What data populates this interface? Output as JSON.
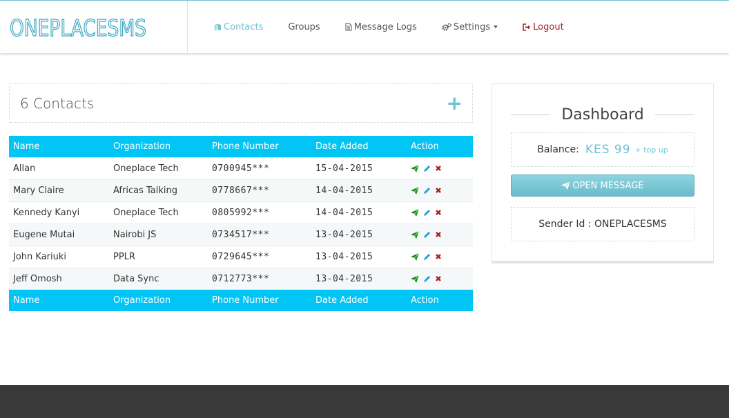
{
  "brand": {
    "name": "ONEPLACESMS"
  },
  "nav": {
    "items": [
      {
        "label": "Contacts",
        "icon": "book-icon",
        "active": true
      },
      {
        "label": "Groups",
        "icon": "",
        "active": false
      },
      {
        "label": "Message Logs",
        "icon": "file-text-icon",
        "active": false
      },
      {
        "label": "Settings",
        "icon": "cogs-icon",
        "active": false,
        "dropdown": true
      },
      {
        "label": "Logout",
        "icon": "sign-out-icon",
        "active": false
      }
    ]
  },
  "contacts": {
    "title": "6 Contacts",
    "add_label": "+",
    "columns": [
      "Name",
      "Organization",
      "Phone Number",
      "Date Added",
      "Action"
    ],
    "rows": [
      {
        "name": "Allan",
        "organization": "Oneplace Tech",
        "phone": "0700945***",
        "date": "15-04-2015"
      },
      {
        "name": "Mary Claire",
        "organization": "Africas Talking",
        "phone": "0778667***",
        "date": "14-04-2015"
      },
      {
        "name": "Kennedy Kanyi",
        "organization": "Oneplace Tech",
        "phone": "0805992***",
        "date": "14-04-2015"
      },
      {
        "name": "Eugene Mutai",
        "organization": "Nairobi JS",
        "phone": "0734517***",
        "date": "13-04-2015"
      },
      {
        "name": "John Kariuki",
        "organization": "PPLR",
        "phone": "0729645***",
        "date": "13-04-2015"
      },
      {
        "name": "Jeff Omosh",
        "organization": "Data Sync",
        "phone": "0712773***",
        "date": "13-04-2015"
      }
    ]
  },
  "dashboard": {
    "title": "Dashboard",
    "balance_label": "Balance:",
    "balance_value": "KES 99",
    "topup_label": "+ top up",
    "open_message_label": "OPEN MESSAGE",
    "sender_id": "Sender Id : ONEPLACESMS"
  },
  "colors": {
    "accent": "#6cc3d5",
    "table_header": "#00c5f5",
    "logout": "#a4212c",
    "send_icon": "#1a8a1a",
    "edit_icon": "#1aa0d8",
    "delete_icon": "#b02020",
    "footer": "#393939"
  }
}
